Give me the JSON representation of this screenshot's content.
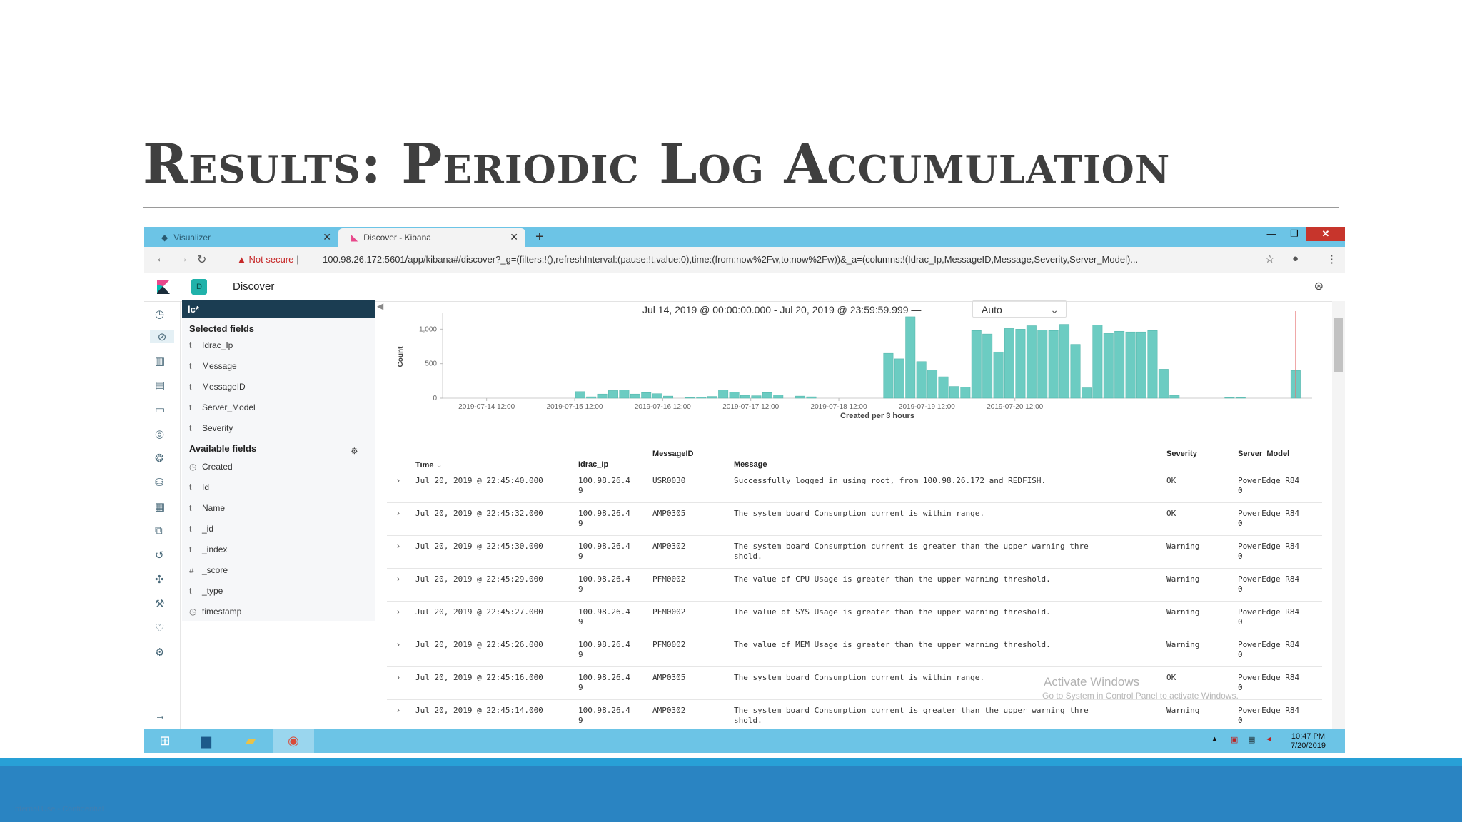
{
  "slide": {
    "title": "Results: Periodic Log Accumulation",
    "footer_text": "Internal Use - Confidential"
  },
  "browser": {
    "tabs": [
      {
        "label": "Visualizer",
        "active": false
      },
      {
        "label": "Discover - Kibana",
        "active": true
      }
    ],
    "not_secure": "Not secure",
    "url": "100.98.26.172:5601/app/kibana#/discover?_g=(filters:!(),refreshInterval:(pause:!t,value:0),time:(from:now%2Fw,to:now%2Fw))&_a=(columns:!(Idrac_Ip,MessageID,Message,Severity,Server_Model)..."
  },
  "kibana": {
    "space_badge": "D",
    "breadcrumb": "Discover",
    "index_pattern": "lc*",
    "selected_fields_heading": "Selected fields",
    "selected_fields": [
      {
        "type": "t",
        "name": "Idrac_Ip"
      },
      {
        "type": "t",
        "name": "Message"
      },
      {
        "type": "t",
        "name": "MessageID"
      },
      {
        "type": "t",
        "name": "Server_Model"
      },
      {
        "type": "t",
        "name": "Severity"
      }
    ],
    "available_fields_heading": "Available fields",
    "available_fields": [
      {
        "type": "clock",
        "name": "Created"
      },
      {
        "type": "t",
        "name": "Id"
      },
      {
        "type": "t",
        "name": "Name"
      },
      {
        "type": "t",
        "name": "_id"
      },
      {
        "type": "t",
        "name": "_index"
      },
      {
        "type": "#",
        "name": "_score"
      },
      {
        "type": "t",
        "name": "_type"
      },
      {
        "type": "clock",
        "name": "timestamp"
      }
    ],
    "time_range": "Jul 14, 2019 @ 00:00:00.000 - Jul 20, 2019 @ 23:59:59.999 —",
    "interval": "Auto"
  },
  "chart_data": {
    "type": "bar",
    "ylabel": "Count",
    "xlabel": "Created per 3 hours",
    "ylim": [
      0,
      1200
    ],
    "yticks": [
      0,
      500,
      1000
    ],
    "ytick_labels": [
      "0",
      "500",
      "1,000"
    ],
    "xtick_labels": [
      "2019-07-14 12:00",
      "2019-07-15 12:00",
      "2019-07-16 12:00",
      "2019-07-17 12:00",
      "2019-07-18 12:00",
      "2019-07-19 12:00",
      "2019-07-20 12:00"
    ],
    "color": "#6cccc2",
    "values": [
      0,
      0,
      0,
      0,
      0,
      0,
      0,
      0,
      0,
      0,
      0,
      0,
      95,
      20,
      60,
      110,
      120,
      60,
      80,
      65,
      30,
      0,
      10,
      15,
      25,
      120,
      90,
      40,
      35,
      80,
      45,
      0,
      30,
      20,
      0,
      0,
      0,
      0,
      0,
      0,
      650,
      570,
      1180,
      530,
      410,
      310,
      170,
      160,
      980,
      930,
      670,
      1010,
      1000,
      1050,
      990,
      980,
      1070,
      780,
      150,
      1060,
      940,
      970,
      960,
      960,
      980,
      420,
      40,
      0,
      0,
      0,
      0,
      10,
      10,
      0,
      0,
      0,
      0,
      400,
      0
    ],
    "reference_line_at_index": 77
  },
  "table": {
    "columns": [
      "Time",
      "Idrac_Ip",
      "MessageID",
      "Message",
      "Severity",
      "Server_Model"
    ],
    "rows": [
      {
        "time": "Jul 20, 2019 @ 22:45:40.000",
        "ip": "100.98.26.4\n9",
        "msgid": "USR0030",
        "msg": "Successfully logged in using root, from 100.98.26.172 and REDFISH.",
        "sev": "OK",
        "model": "PowerEdge R84\n0"
      },
      {
        "time": "Jul 20, 2019 @ 22:45:32.000",
        "ip": "100.98.26.4\n9",
        "msgid": "AMP0305",
        "msg": "The system board Consumption current is within range.",
        "sev": "OK",
        "model": "PowerEdge R84\n0"
      },
      {
        "time": "Jul 20, 2019 @ 22:45:30.000",
        "ip": "100.98.26.4\n9",
        "msgid": "AMP0302",
        "msg": "The system board Consumption current is greater than the upper warning thre\nshold.",
        "sev": "Warning",
        "model": "PowerEdge R84\n0"
      },
      {
        "time": "Jul 20, 2019 @ 22:45:29.000",
        "ip": "100.98.26.4\n9",
        "msgid": "PFM0002",
        "msg": "The value of CPU Usage is greater than the upper warning threshold.",
        "sev": "Warning",
        "model": "PowerEdge R84\n0"
      },
      {
        "time": "Jul 20, 2019 @ 22:45:27.000",
        "ip": "100.98.26.4\n9",
        "msgid": "PFM0002",
        "msg": "The value of SYS Usage is greater than the upper warning threshold.",
        "sev": "Warning",
        "model": "PowerEdge R84\n0"
      },
      {
        "time": "Jul 20, 2019 @ 22:45:26.000",
        "ip": "100.98.26.4\n9",
        "msgid": "PFM0002",
        "msg": "The value of MEM Usage is greater than the upper warning threshold.",
        "sev": "Warning",
        "model": "PowerEdge R84\n0"
      },
      {
        "time": "Jul 20, 2019 @ 22:45:16.000",
        "ip": "100.98.26.4\n9",
        "msgid": "AMP0305",
        "msg": "The system board Consumption current is within range.",
        "sev": "OK",
        "model": "PowerEdge R84\n0"
      },
      {
        "time": "Jul 20, 2019 @ 22:45:14.000",
        "ip": "100.98.26.4\n9",
        "msgid": "AMP0302",
        "msg": "The system board Consumption current is greater than the upper warning thre\nshold.",
        "sev": "Warning",
        "model": "PowerEdge R84\n0"
      }
    ]
  },
  "overlay": {
    "activate_title": "Activate Windows",
    "activate_sub": "Go to System in Control Panel to activate Windows."
  },
  "taskbar": {
    "time": "10:47 PM",
    "date": "7/20/2019"
  }
}
